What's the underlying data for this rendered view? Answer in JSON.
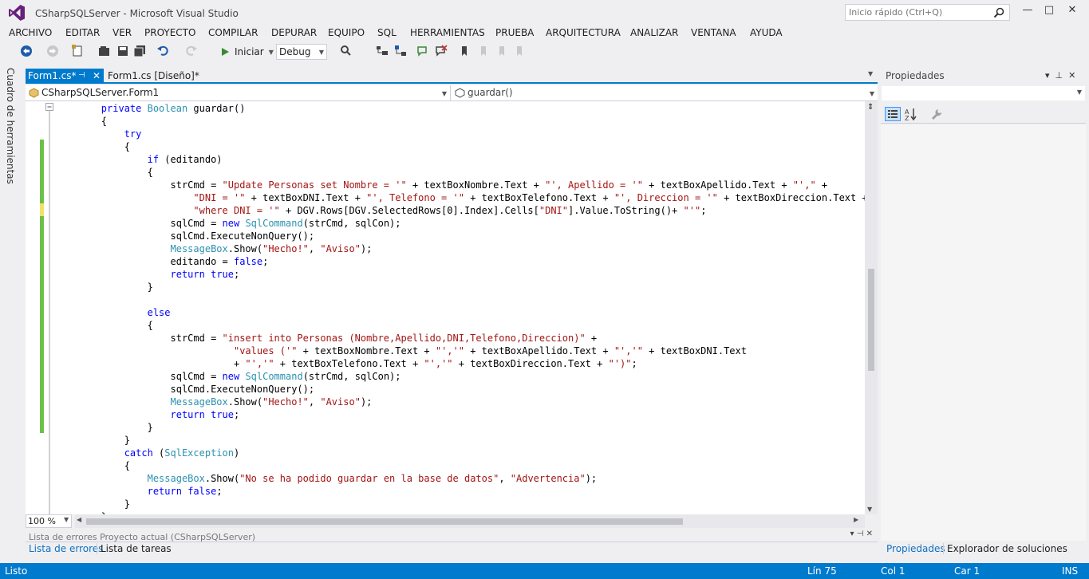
{
  "window": {
    "title": "CSharpSQLServer - Microsoft Visual Studio",
    "quick_launch_placeholder": "Inicio rápido (Ctrl+Q)",
    "minimize": "—",
    "maximize": "□",
    "close": "✕"
  },
  "menu": [
    "ARCHIVO",
    "EDITAR",
    "VER",
    "PROYECTO",
    "COMPILAR",
    "DEPURAR",
    "EQUIPO",
    "SQL",
    "HERRAMIENTAS",
    "PRUEBA",
    "ARQUITECTURA",
    "ANALIZAR",
    "VENTANA",
    "AYUDA"
  ],
  "toolbar": {
    "start_label": "Iniciar",
    "configuration": "Debug"
  },
  "toolbox": {
    "label": "Cuadro de herramientas"
  },
  "tabs": {
    "active": "Form1.cs*",
    "second": "Form1.cs [Diseño]*"
  },
  "navbar": {
    "class": "CSharpSQLServer.Form1",
    "member": "guardar()"
  },
  "code": {
    "lines": [
      [
        [
          "        ",
          ""
        ],
        [
          "private",
          "kw"
        ],
        [
          " ",
          ""
        ],
        [
          "Boolean",
          "ty"
        ],
        [
          " guardar()",
          ""
        ]
      ],
      [
        [
          "        {",
          ""
        ]
      ],
      [
        [
          "            ",
          ""
        ],
        [
          "try",
          "kw"
        ]
      ],
      [
        [
          "            {",
          ""
        ]
      ],
      [
        [
          "                ",
          ""
        ],
        [
          "if",
          "kw"
        ],
        [
          " (editando)",
          ""
        ]
      ],
      [
        [
          "                {",
          ""
        ]
      ],
      [
        [
          "                    strCmd = ",
          ""
        ],
        [
          "\"Update Personas set Nombre = '\"",
          "str"
        ],
        [
          " + textBoxNombre.Text + ",
          ""
        ],
        [
          "\"', Apellido = '\"",
          "str"
        ],
        [
          " + textBoxApellido.Text + ",
          ""
        ],
        [
          "\"',\"",
          "str"
        ],
        [
          " +",
          ""
        ]
      ],
      [
        [
          "                        ",
          ""
        ],
        [
          "\"DNI = '\"",
          "str"
        ],
        [
          " + textBoxDNI.Text + ",
          ""
        ],
        [
          "\"', Telefono = '\"",
          "str"
        ],
        [
          " + textBoxTelefono.Text + ",
          ""
        ],
        [
          "\"', Direccion = '\"",
          "str"
        ],
        [
          " + textBoxDireccion.Text + ",
          ""
        ],
        [
          "\"'",
          "str"
        ]
      ],
      [
        [
          "                        ",
          ""
        ],
        [
          "\"where DNI = '\"",
          "str"
        ],
        [
          " + DGV.Rows[DGV.SelectedRows[0].Index].Cells[",
          ""
        ],
        [
          "\"DNI\"",
          "str"
        ],
        [
          "].Value.ToString()+ ",
          ""
        ],
        [
          "\"'\"",
          "str"
        ],
        [
          ";",
          ""
        ]
      ],
      [
        [
          "                    sqlCmd = ",
          ""
        ],
        [
          "new",
          "kw"
        ],
        [
          " ",
          ""
        ],
        [
          "SqlCommand",
          "ty"
        ],
        [
          "(strCmd, sqlCon);",
          ""
        ]
      ],
      [
        [
          "                    sqlCmd.ExecuteNonQuery();",
          ""
        ]
      ],
      [
        [
          "                    ",
          ""
        ],
        [
          "MessageBox",
          "ty"
        ],
        [
          ".Show(",
          ""
        ],
        [
          "\"Hecho!\"",
          "str"
        ],
        [
          ", ",
          ""
        ],
        [
          "\"Aviso\"",
          "str"
        ],
        [
          ");",
          ""
        ]
      ],
      [
        [
          "                    editando = ",
          ""
        ],
        [
          "false",
          "kw"
        ],
        [
          ";",
          ""
        ]
      ],
      [
        [
          "                    ",
          ""
        ],
        [
          "return",
          "kw"
        ],
        [
          " ",
          ""
        ],
        [
          "true",
          "kw"
        ],
        [
          ";",
          ""
        ]
      ],
      [
        [
          "                }",
          ""
        ]
      ],
      [
        [
          "",
          ""
        ]
      ],
      [
        [
          "                ",
          ""
        ],
        [
          "else",
          "kw"
        ]
      ],
      [
        [
          "                {",
          ""
        ]
      ],
      [
        [
          "                    strCmd = ",
          ""
        ],
        [
          "\"insert into Personas (Nombre,Apellido,DNI,Telefono,Direccion)\"",
          "str"
        ],
        [
          " +",
          ""
        ]
      ],
      [
        [
          "                               ",
          ""
        ],
        [
          "\"values ('\"",
          "str"
        ],
        [
          " + textBoxNombre.Text + ",
          ""
        ],
        [
          "\"','\"",
          "str"
        ],
        [
          " + textBoxApellido.Text + ",
          ""
        ],
        [
          "\"','\"",
          "str"
        ],
        [
          " + textBoxDNI.Text",
          ""
        ]
      ],
      [
        [
          "                               + ",
          ""
        ],
        [
          "\"','\"",
          "str"
        ],
        [
          " + textBoxTelefono.Text + ",
          ""
        ],
        [
          "\"','\"",
          "str"
        ],
        [
          " + textBoxDireccion.Text + ",
          ""
        ],
        [
          "\"')\"",
          "str"
        ],
        [
          ";",
          ""
        ]
      ],
      [
        [
          "                    sqlCmd = ",
          ""
        ],
        [
          "new",
          "kw"
        ],
        [
          " ",
          ""
        ],
        [
          "SqlCommand",
          "ty"
        ],
        [
          "(strCmd, sqlCon);",
          ""
        ]
      ],
      [
        [
          "                    sqlCmd.ExecuteNonQuery();",
          ""
        ]
      ],
      [
        [
          "                    ",
          ""
        ],
        [
          "MessageBox",
          "ty"
        ],
        [
          ".Show(",
          ""
        ],
        [
          "\"Hecho!\"",
          "str"
        ],
        [
          ", ",
          ""
        ],
        [
          "\"Aviso\"",
          "str"
        ],
        [
          ");",
          ""
        ]
      ],
      [
        [
          "                    ",
          ""
        ],
        [
          "return",
          "kw"
        ],
        [
          " ",
          ""
        ],
        [
          "true",
          "kw"
        ],
        [
          ";",
          ""
        ]
      ],
      [
        [
          "                }",
          ""
        ]
      ],
      [
        [
          "            }",
          ""
        ]
      ],
      [
        [
          "            ",
          ""
        ],
        [
          "catch",
          "kw"
        ],
        [
          " (",
          ""
        ],
        [
          "SqlException",
          "ty"
        ],
        [
          ")",
          ""
        ]
      ],
      [
        [
          "            {",
          ""
        ]
      ],
      [
        [
          "                ",
          ""
        ],
        [
          "MessageBox",
          "ty"
        ],
        [
          ".Show(",
          ""
        ],
        [
          "\"No se ha podido guardar en la base de datos\"",
          "str"
        ],
        [
          ", ",
          ""
        ],
        [
          "\"Advertencia\"",
          "str"
        ],
        [
          ");",
          ""
        ]
      ],
      [
        [
          "                ",
          ""
        ],
        [
          "return",
          "kw"
        ],
        [
          " ",
          ""
        ],
        [
          "false",
          "kw"
        ],
        [
          ";",
          ""
        ]
      ],
      [
        [
          "            }",
          ""
        ]
      ],
      [
        [
          "        }",
          ""
        ]
      ]
    ]
  },
  "editor": {
    "zoom": "100 %"
  },
  "bottom_panel": {
    "strip_text": "Lista de errores   Proyecto actual (CSharpSQLServer)",
    "tab_errors": "Lista de errores",
    "tab_tasks": "Lista de tareas"
  },
  "properties": {
    "title": "Propiedades",
    "tab_properties": "Propiedades",
    "tab_solution": "Explorador de soluciones"
  },
  "status": {
    "state": "Listo",
    "line": "Lín 75",
    "col": "Col 1",
    "char": "Car 1",
    "mode": "INS"
  },
  "colors": {
    "accent": "#007ACC",
    "keyword": "#0000FF",
    "type": "#2B91AF",
    "string": "#A31515",
    "change_saved": "#6CC04A",
    "change_unsaved": "#EFE366"
  }
}
